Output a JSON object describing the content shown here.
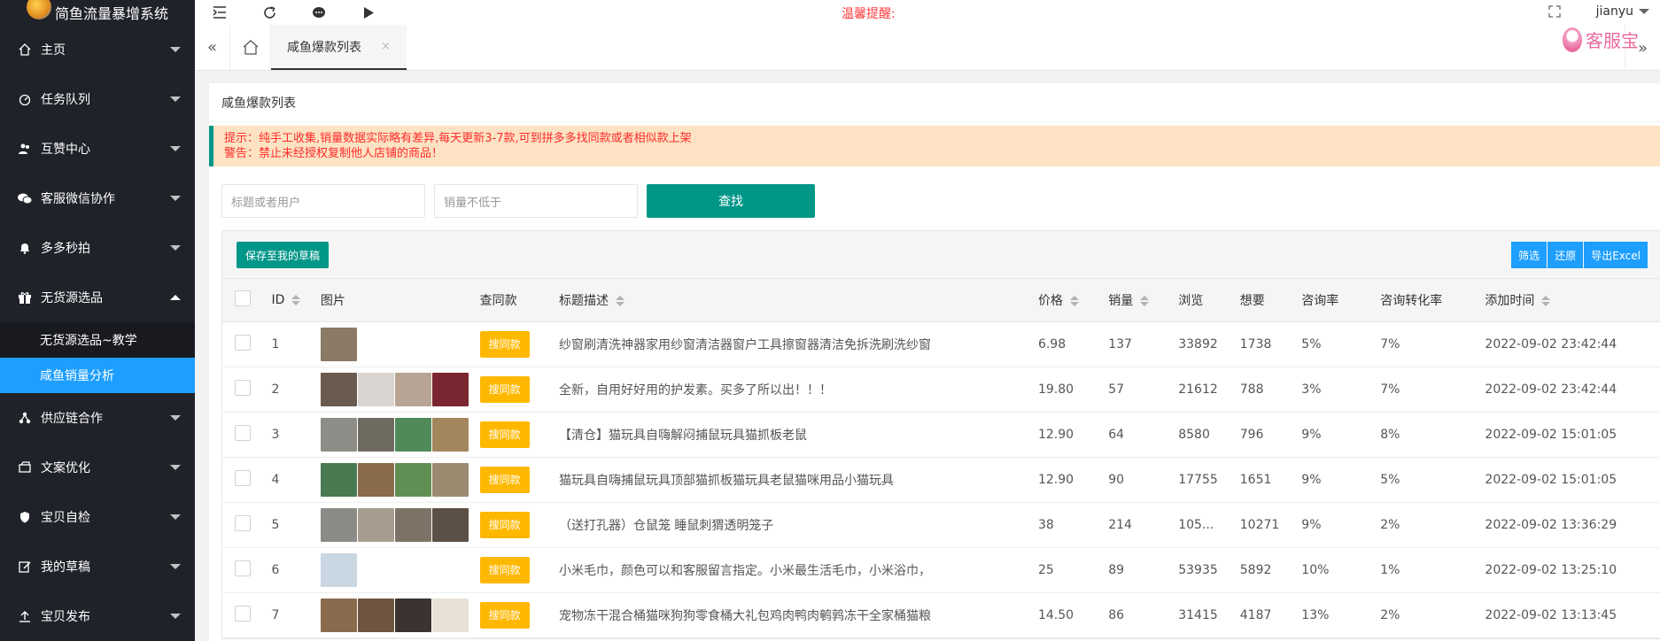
{
  "app": {
    "title": "简鱼流量暴增系统"
  },
  "sidebar": {
    "items": [
      {
        "label": "主页",
        "icon": "home-icon"
      },
      {
        "label": "任务队列",
        "icon": "dashboard-icon"
      },
      {
        "label": "互赞中心",
        "icon": "users-icon"
      },
      {
        "label": "客服微信协作",
        "icon": "wechat-icon"
      },
      {
        "label": "多多秒拍",
        "icon": "bell-icon"
      },
      {
        "label": "无货源选品",
        "icon": "gift-icon"
      },
      {
        "label": "供应链合作",
        "icon": "sitemap-icon"
      },
      {
        "label": "文案优化",
        "icon": "print-icon"
      },
      {
        "label": "宝贝自检",
        "icon": "shield-icon"
      },
      {
        "label": "我的草稿",
        "icon": "edit-icon"
      },
      {
        "label": "宝贝发布",
        "icon": "upload-icon"
      }
    ],
    "submenu": [
      {
        "label": "无货源选品~教学",
        "active": false
      },
      {
        "label": "咸鱼销量分析",
        "active": true
      }
    ]
  },
  "topbar": {
    "notice": "温馨提醒:",
    "user": "jianyu"
  },
  "tabs": {
    "active_label": "咸鱼爆款列表",
    "close": "×"
  },
  "kefu": {
    "label": "客服宝"
  },
  "card": {
    "title": "咸鱼爆款列表",
    "tip1": "提示：纯手工收集,销量数据实际略有差异,每天更新3-7款,可到拼多多找同款或者相似款上架",
    "tip2": "警告：禁止未经授权复制他人店铺的商品！"
  },
  "search": {
    "title_placeholder": "标题或者用户",
    "sales_placeholder": "销量不低于",
    "button": "查找"
  },
  "toolbar": {
    "save": "保存至我的草稿",
    "filter": "筛选",
    "reset": "还原",
    "export": "导出Excel"
  },
  "table": {
    "headers": {
      "id": "ID",
      "image": "图片",
      "same": "查同款",
      "desc": "标题描述",
      "price": "价格",
      "sales": "销量",
      "views": "浏览",
      "wants": "想要",
      "inquiry": "咨询率",
      "conversion": "咨询转化率",
      "added": "添加时间"
    },
    "same_btn": "搜同款",
    "rows": [
      {
        "id": "1",
        "desc": "纱窗刷清洗神器家用纱窗清洁器窗户工具擦窗器清洁免拆洗刷洗纱窗",
        "price": "6.98",
        "sales": "137",
        "views": "33892",
        "wants": "1738",
        "inquiry": "5%",
        "conversion": "7%",
        "added": "2022-09-02 23:42:44",
        "thumbs": [
          "#8a7a66"
        ]
      },
      {
        "id": "2",
        "desc": "全新，自用好好用的护发素。买多了所以出！！！",
        "price": "19.80",
        "sales": "57",
        "views": "21612",
        "wants": "788",
        "inquiry": "3%",
        "conversion": "7%",
        "added": "2022-09-02 23:42:44",
        "thumbs": [
          "#6b5a4e",
          "#d9d4cf",
          "#b8a494",
          "#7a2630"
        ]
      },
      {
        "id": "3",
        "desc": "【清仓】猫玩具自嗨解闷捕鼠玩具猫抓板老鼠",
        "price": "12.90",
        "sales": "64",
        "views": "8580",
        "wants": "796",
        "inquiry": "9%",
        "conversion": "8%",
        "added": "2022-09-02 15:01:05",
        "thumbs": [
          "#8d8c86",
          "#6f6a60",
          "#4f8a58",
          "#a4865d"
        ]
      },
      {
        "id": "4",
        "desc": "猫玩具自嗨捕鼠玩具顶部猫抓板猫玩具老鼠猫咪用品小猫玩具",
        "price": "12.90",
        "sales": "90",
        "views": "17755",
        "wants": "1651",
        "inquiry": "9%",
        "conversion": "5%",
        "added": "2022-09-02 15:01:05",
        "thumbs": [
          "#4a7a52",
          "#8a6b4a",
          "#5f8f52",
          "#9a8a70"
        ]
      },
      {
        "id": "5",
        "desc": "（送打孔器）仓鼠笼 睡鼠刺猬透明笼子",
        "price": "38",
        "sales": "214",
        "views": "105...",
        "wants": "10271",
        "inquiry": "9%",
        "conversion": "2%",
        "added": "2022-09-02 13:36:29",
        "thumbs": [
          "#8a8a86",
          "#a69d90",
          "#7d7266",
          "#5c4f45"
        ]
      },
      {
        "id": "6",
        "desc": "小米毛巾，颜色可以和客服留言指定。小米最生活毛巾，小米浴巾，",
        "price": "25",
        "sales": "89",
        "views": "53935",
        "wants": "5892",
        "inquiry": "10%",
        "conversion": "1%",
        "added": "2022-09-02 13:25:10",
        "thumbs": [
          "#c9d7e3"
        ]
      },
      {
        "id": "7",
        "desc": "宠物冻干混合桶猫咪狗狗零食桶大礼包鸡肉鸭肉鹌鹑冻干全家桶猫粮",
        "price": "14.50",
        "sales": "86",
        "views": "31415",
        "wants": "4187",
        "inquiry": "13%",
        "conversion": "2%",
        "added": "2022-09-02 13:13:45",
        "thumbs": [
          "#8a6b4e",
          "#6e5540",
          "#3a3330",
          "#e8e1d6"
        ]
      }
    ]
  }
}
